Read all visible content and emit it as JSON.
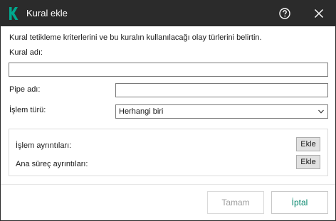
{
  "window": {
    "title": "Kural ekle",
    "icons": {
      "logo": "kaspersky-k-logo",
      "help": "help-icon",
      "close": "close-icon"
    },
    "colors": {
      "titlebar": "#2b2b2b",
      "brand": "#00a88e",
      "primary_text": "#00846a"
    }
  },
  "form": {
    "description": "Kural tetikleme kriterlerini ve bu kuralın kullanılacağı olay türlerini belirtin.",
    "rule_name_label": "Kural adı:",
    "rule_name_value": "",
    "pipe_name_label": "Pipe adı:",
    "pipe_name_value": "",
    "operation_type_label": "İşlem türü:",
    "operation_type_selected": "Herhangi biri"
  },
  "details": {
    "operation_details_label": "İşlem ayrıntıları:",
    "operation_details_button": "Ekle",
    "parent_process_label": "Ana süreç ayrıntıları:",
    "parent_process_button": "Ekle"
  },
  "footer": {
    "ok_label": "Tamam",
    "cancel_label": "İptal"
  }
}
